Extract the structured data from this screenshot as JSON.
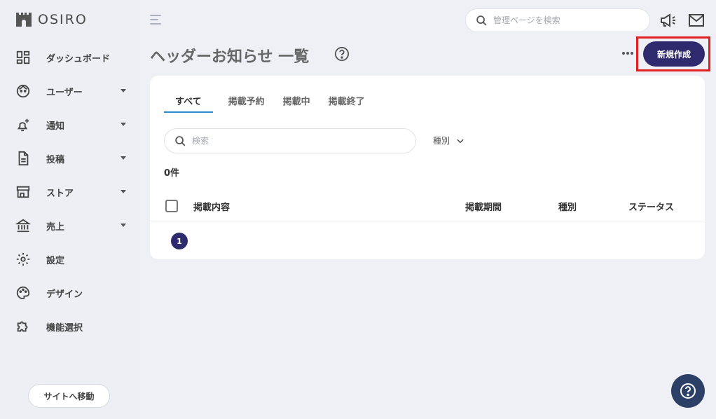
{
  "brand": {
    "name": "OSIRO"
  },
  "sidebar": {
    "items": [
      {
        "label": "ダッシュボード",
        "icon": "dashboard-icon",
        "has_submenu": false
      },
      {
        "label": "ユーザー",
        "icon": "user-face-icon",
        "has_submenu": true
      },
      {
        "label": "通知",
        "icon": "bell-plus-icon",
        "has_submenu": true
      },
      {
        "label": "投稿",
        "icon": "document-icon",
        "has_submenu": true
      },
      {
        "label": "ストア",
        "icon": "store-icon",
        "has_submenu": true
      },
      {
        "label": "売上",
        "icon": "bank-icon",
        "has_submenu": true
      },
      {
        "label": "設定",
        "icon": "gear-icon",
        "has_submenu": false
      },
      {
        "label": "デザイン",
        "icon": "palette-icon",
        "has_submenu": false
      },
      {
        "label": "機能選択",
        "icon": "puzzle-icon",
        "has_submenu": false
      }
    ],
    "site_button_label": "サイトへ移動"
  },
  "header": {
    "search_placeholder": "管理ページを検索"
  },
  "page": {
    "title": "ヘッダーお知らせ 一覧",
    "new_button_label": "新規作成"
  },
  "card": {
    "tabs": [
      {
        "label": "すべて",
        "active": true
      },
      {
        "label": "掲載予約",
        "active": false
      },
      {
        "label": "掲載中",
        "active": false
      },
      {
        "label": "掲載終了",
        "active": false
      }
    ],
    "search_placeholder": "検索",
    "type_filter_label": "種別",
    "count_label": "0件",
    "columns": [
      "掲載内容",
      "掲載期間",
      "種別",
      "ステータス"
    ],
    "current_page": "1"
  },
  "colors": {
    "accent": "#2f2a6e",
    "highlight": "#e02020",
    "tab_underline": "#2f8ccf",
    "help_fab": "#2c3f66"
  }
}
